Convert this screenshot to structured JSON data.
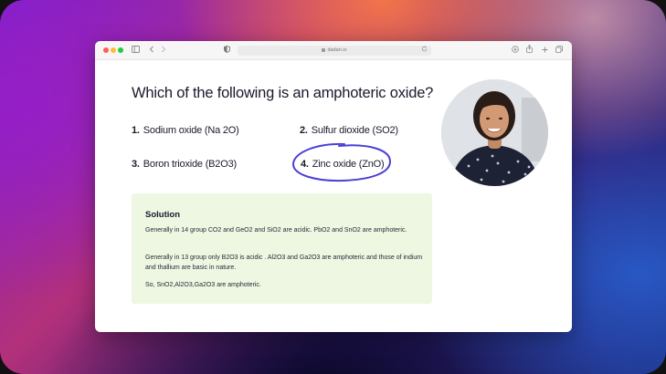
{
  "browser": {
    "url": "dadan.io"
  },
  "quiz": {
    "question": "Which of the following is an amphoteric oxide?",
    "options": [
      {
        "number": "1.",
        "text": "Sodium oxide (Na 2O)"
      },
      {
        "number": "2.",
        "text": "Sulfur dioxide (SO2)"
      },
      {
        "number": "3.",
        "text": "Boron trioxide (B2O3)"
      },
      {
        "number": "4.",
        "text": "Zinc oxide (ZnO)"
      }
    ],
    "selected_option": 4,
    "highlight_color": "#4b3fd6"
  },
  "solution": {
    "title": "Solution",
    "paragraphs": [
      "Generally in 14 group CO2 and GeO2 and SiO2 are acidic. PbO2 and SnO2 are amphoteric.",
      "Generally in 13 group only B2O3 is acidic . Al2O3 and Ga2O3 are amphoteric and those of indium and thallium are basic in nature.",
      "So, SnO2,Al2O3,Ga2O3 are amphoteric."
    ],
    "background_color": "#edf7e1"
  },
  "icons": [
    "sidebar-icon",
    "back-icon",
    "forward-icon",
    "shield-icon",
    "lock-icon",
    "reload-icon",
    "download-icon",
    "share-icon",
    "new-tab-icon",
    "tabs-icon"
  ]
}
